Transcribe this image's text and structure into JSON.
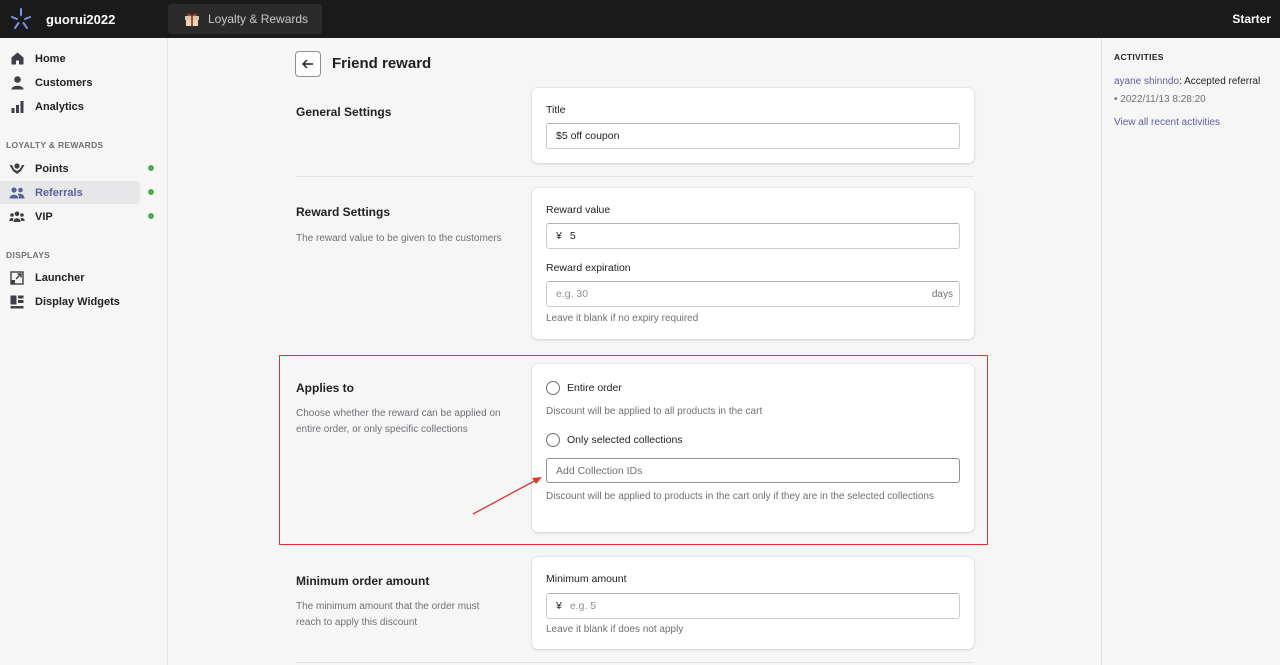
{
  "topbar": {
    "shop_name": "guorui2022",
    "app_tab": "Loyalty & Rewards",
    "plan": "Starter"
  },
  "sidebar": {
    "items": [
      {
        "label": "Home",
        "icon": "home-icon"
      },
      {
        "label": "Customers",
        "icon": "person-icon"
      },
      {
        "label": "Analytics",
        "icon": "bar-chart-icon"
      }
    ],
    "section_loyalty": "LOYALTY & REWARDS",
    "loyalty_items": [
      {
        "label": "Points",
        "icon": "hands-coin-icon",
        "status": "enabled"
      },
      {
        "label": "Referrals",
        "icon": "people-icon",
        "status": "enabled",
        "active": true
      },
      {
        "label": "VIP",
        "icon": "group-icon",
        "status": "enabled"
      }
    ],
    "section_displays": "DISPLAYS",
    "display_items": [
      {
        "label": "Launcher",
        "icon": "launcher-icon"
      },
      {
        "label": "Display Widgets",
        "icon": "widgets-icon"
      }
    ]
  },
  "page": {
    "title": "Friend reward"
  },
  "general": {
    "title": "General Settings",
    "field_label": "Title",
    "field_value": "$5 off coupon"
  },
  "reward": {
    "title": "Reward Settings",
    "desc": "The reward value to be given to the customers",
    "value_label": "Reward value",
    "currency": "¥",
    "value": "5",
    "expiration_label": "Reward expiration",
    "expiration_placeholder": "e.g. 30",
    "expiration_suffix": "days",
    "expiration_help": "Leave it blank if no expiry required"
  },
  "applies": {
    "title": "Applies to",
    "desc": "Choose whether the reward can be applied on entire order, or only specific collections",
    "option_entire": "Entire order",
    "entire_help": "Discount will be applied to all products in the cart",
    "option_collections": "Only selected collections",
    "collections_placeholder": "Add Collection IDs",
    "collections_help": "Discount will be applied to products in the cart only if they are in the selected collections"
  },
  "minimum": {
    "title": "Minimum order amount",
    "desc": "The minimum amount that the order must reach to apply this discount",
    "label": "Minimum amount",
    "currency": "¥",
    "placeholder": "e.g. 5",
    "help": "Leave it blank if does not apply"
  },
  "activities": {
    "title": "ACTIVITIES",
    "user": "ayane shinndo",
    "action": ": Accepted referral",
    "time": "• 2022/11/13 8:28:20",
    "view_all": "View all recent activities"
  },
  "colors": {
    "accent": "#5c5f9e",
    "status_green": "#4caf50",
    "highlight_red": "#e0342e"
  }
}
